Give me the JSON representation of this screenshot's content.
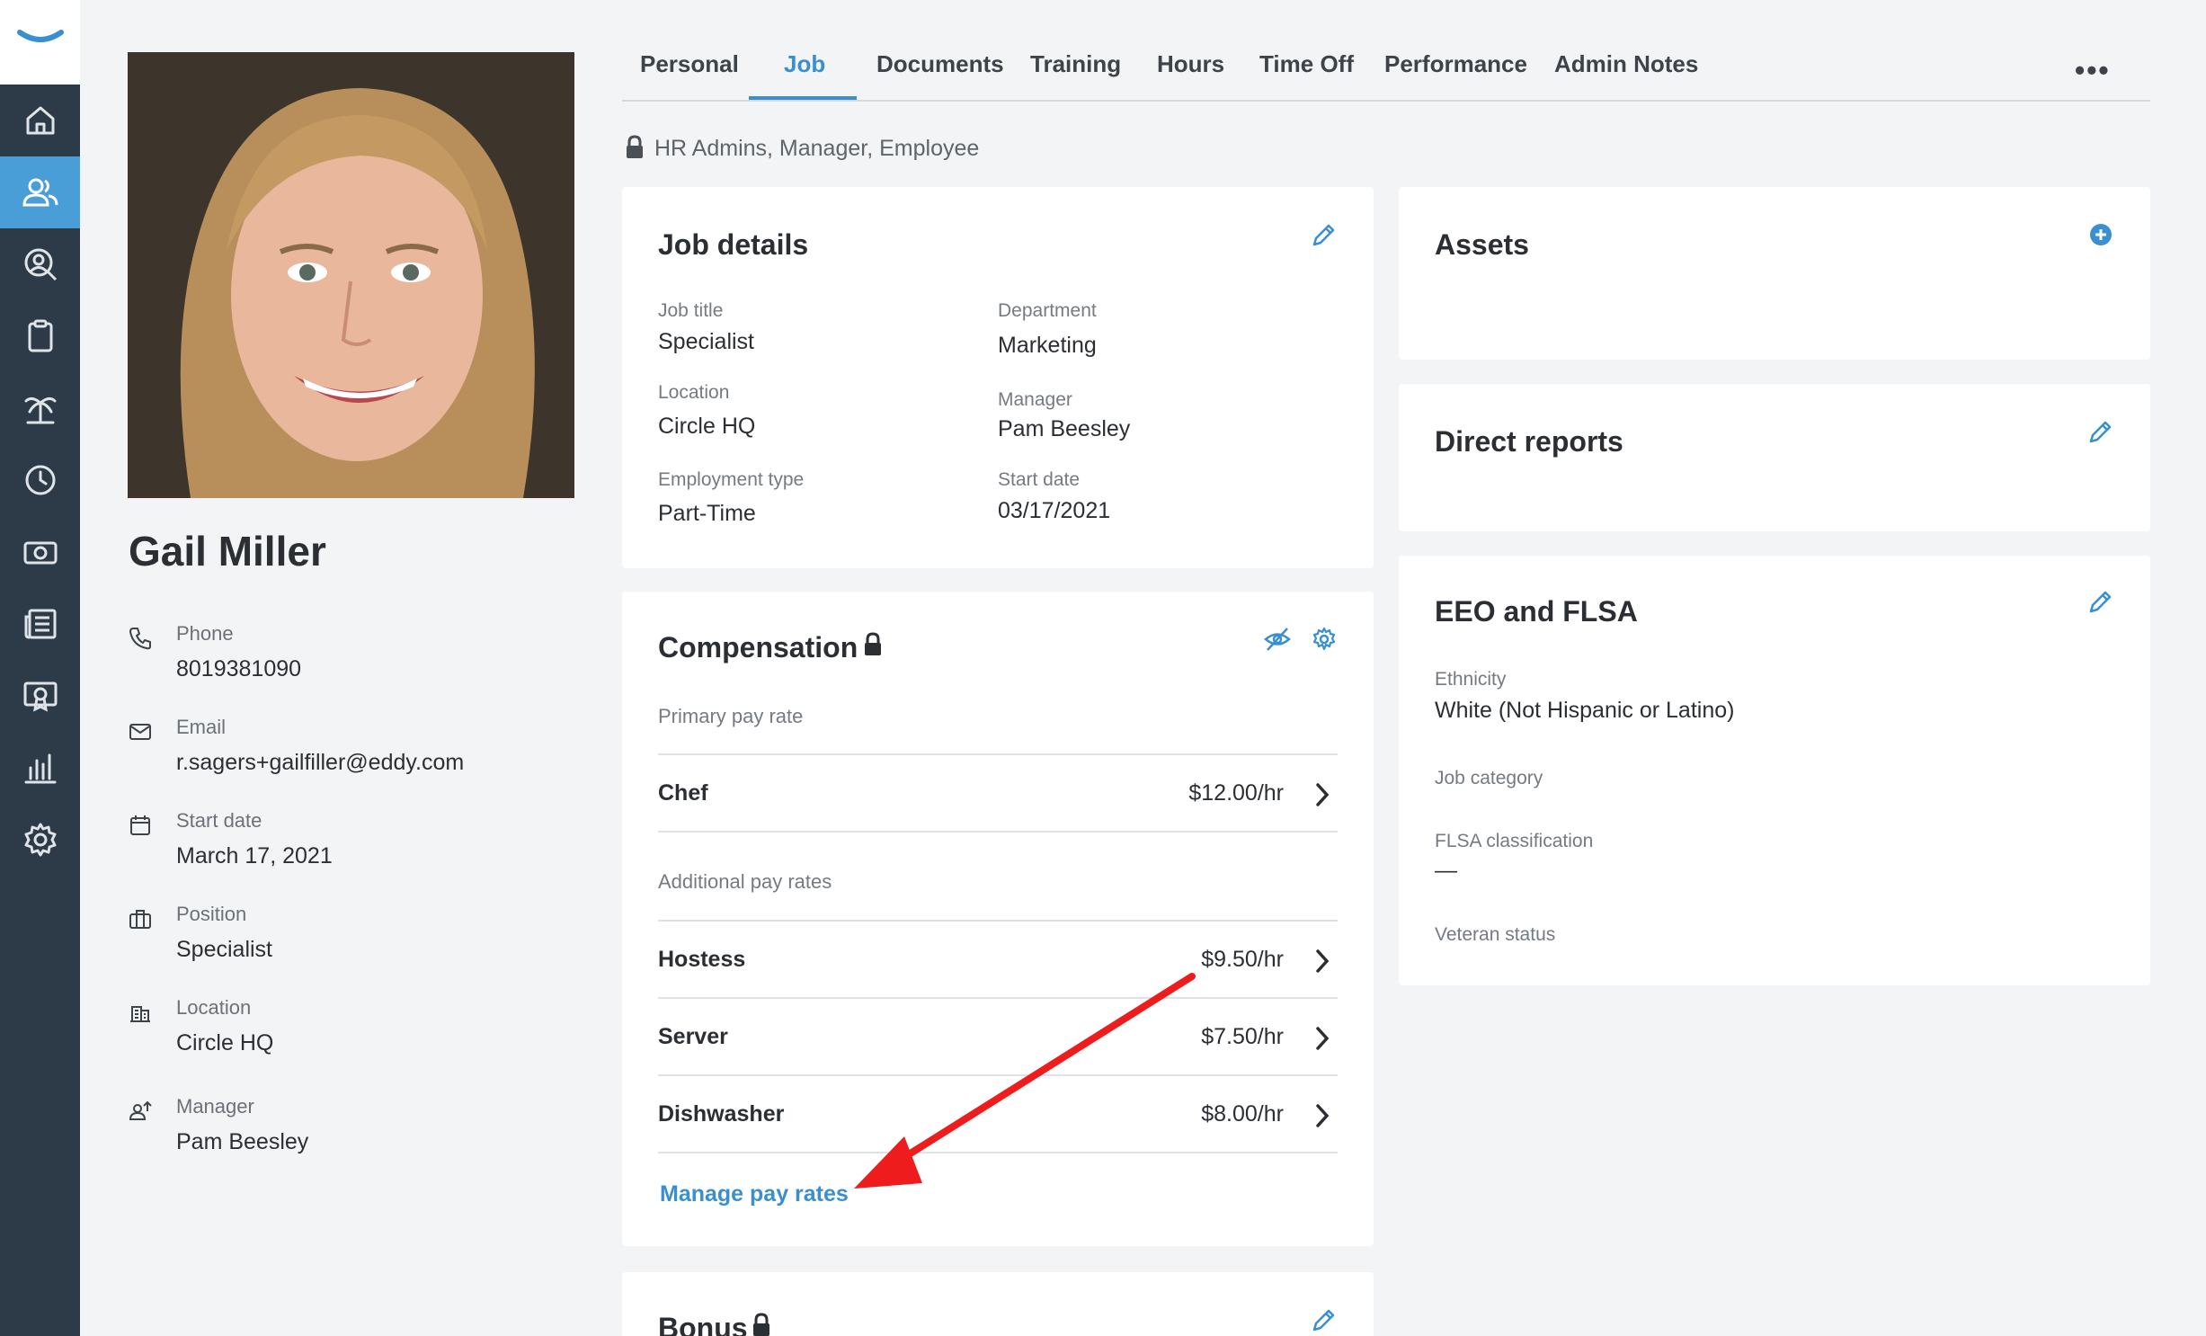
{
  "nav": {
    "items": [
      {
        "icon": "home-icon",
        "active": false
      },
      {
        "icon": "people-icon",
        "active": true
      },
      {
        "icon": "user-search-icon",
        "active": false
      },
      {
        "icon": "clipboard-icon",
        "active": false
      },
      {
        "icon": "palm-tree-icon",
        "active": false
      },
      {
        "icon": "clock-icon",
        "active": false
      },
      {
        "icon": "money-icon",
        "active": false
      },
      {
        "icon": "news-icon",
        "active": false
      },
      {
        "icon": "certificate-icon",
        "active": false
      },
      {
        "icon": "bar-chart-icon",
        "active": false
      },
      {
        "icon": "gear-icon",
        "active": false
      }
    ]
  },
  "profile": {
    "name": "Gail Miller",
    "phone_label": "Phone",
    "phone": "8019381090",
    "email_label": "Email",
    "email": "r.sagers+gailfiller@eddy.com",
    "start_label": "Start date",
    "start": "March 17, 2021",
    "position_label": "Position",
    "position": "Specialist",
    "location_label": "Location",
    "location": "Circle HQ",
    "manager_label": "Manager",
    "manager": "Pam Beesley"
  },
  "tabs": [
    "Personal",
    "Job",
    "Documents",
    "Training",
    "Hours",
    "Time Off",
    "Performance",
    "Admin Notes"
  ],
  "more": "•••",
  "access": "HR Admins, Manager, Employee",
  "job_details": {
    "title": "Job details",
    "job_title_label": "Job title",
    "job_title": "Specialist",
    "department_label": "Department",
    "department": "Marketing",
    "location_label": "Location",
    "location": "Circle HQ",
    "manager_label": "Manager",
    "manager": "Pam Beesley",
    "employment_type_label": "Employment type",
    "employment_type": "Part-Time",
    "start_date_label": "Start date",
    "start_date": "03/17/2021"
  },
  "compensation": {
    "title": "Compensation",
    "primary_label": "Primary pay rate",
    "primary": {
      "name": "Chef",
      "rate": "$12.00/hr"
    },
    "additional_label": "Additional pay rates",
    "additional": [
      {
        "name": "Hostess",
        "rate": "$9.50/hr"
      },
      {
        "name": "Server",
        "rate": "$7.50/hr"
      },
      {
        "name": "Dishwasher",
        "rate": "$8.00/hr"
      }
    ],
    "manage_link": "Manage pay rates"
  },
  "bonus": {
    "title": "Bonus"
  },
  "assets": {
    "title": "Assets"
  },
  "direct_reports": {
    "title": "Direct reports"
  },
  "eeo": {
    "title": "EEO and FLSA",
    "ethnicity_label": "Ethnicity",
    "ethnicity": "White (Not Hispanic or Latino)",
    "job_category_label": "Job category",
    "flsa_label": "FLSA classification",
    "flsa": "—",
    "veteran_label": "Veteran status"
  },
  "colors": {
    "accent": "#3a8fd0",
    "nav_bg": "#2d3a47",
    "annotation_arrow": "#ee1c1c"
  }
}
